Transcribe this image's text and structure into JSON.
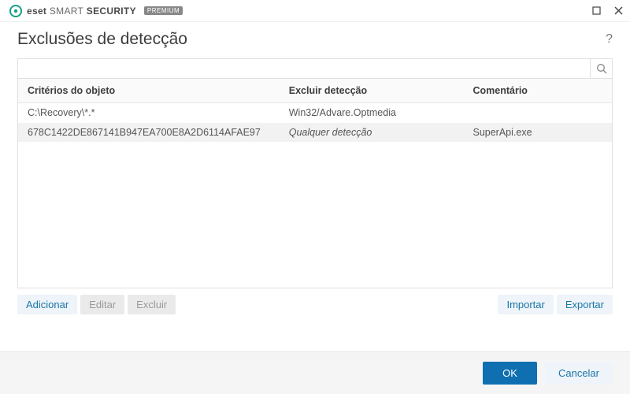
{
  "brand": {
    "eset": "eset",
    "smart": "SMART",
    "security": "SECURITY",
    "tier": "PREMIUM"
  },
  "page": {
    "title": "Exclusões de detecção"
  },
  "search": {
    "value": ""
  },
  "table": {
    "columns": {
      "criteria": "Critérios do objeto",
      "exclude": "Excluir detecção",
      "comment": "Comentário"
    },
    "rows": [
      {
        "criteria": "C:\\Recovery\\*.*",
        "exclude": "Win32/Advare.Optmedia",
        "exclude_italic": false,
        "comment": ""
      },
      {
        "criteria": "678C1422DE867141B947EA700E8A2D6114AFAE97",
        "exclude": "Qualquer detecção",
        "exclude_italic": true,
        "comment": "SuperApi.exe"
      }
    ]
  },
  "actions": {
    "add": "Adicionar",
    "edit": "Editar",
    "delete": "Excluir",
    "import": "Importar",
    "export": "Exportar"
  },
  "footer": {
    "ok": "OK",
    "cancel": "Cancelar"
  }
}
